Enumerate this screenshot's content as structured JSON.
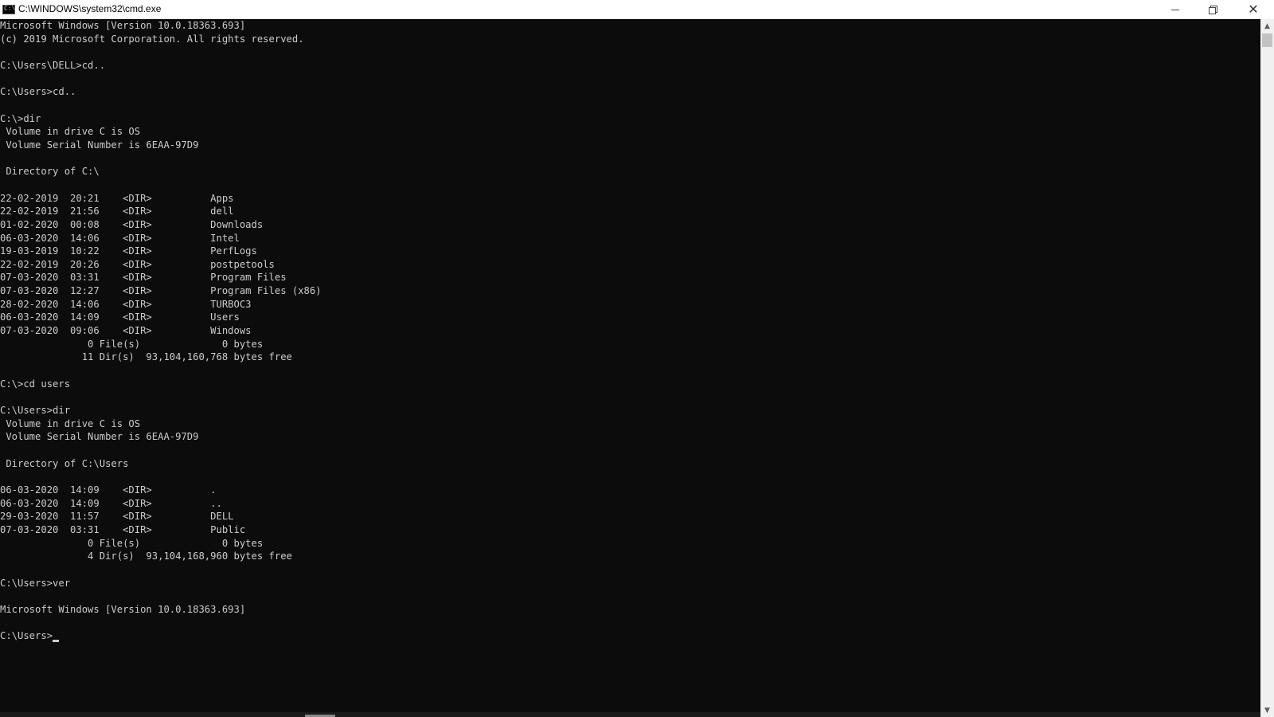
{
  "window": {
    "title": "C:\\WINDOWS\\system32\\cmd.exe",
    "icon": "cmd-icon",
    "icon_glyph": "C:\\",
    "buttons": {
      "minimize": "minimize-icon",
      "maximize": "restore-icon",
      "close": "close-icon",
      "close_glyph": "✕"
    }
  },
  "console": {
    "lines": [
      "Microsoft Windows [Version 10.0.18363.693]",
      "(c) 2019 Microsoft Corporation. All rights reserved.",
      "",
      "C:\\Users\\DELL>cd..",
      "",
      "C:\\Users>cd..",
      "",
      "C:\\>dir",
      " Volume in drive C is OS",
      " Volume Serial Number is 6EAA-97D9",
      "",
      " Directory of C:\\",
      "",
      "22-02-2019  20:21    <DIR>          Apps",
      "22-02-2019  21:56    <DIR>          dell",
      "01-02-2020  00:08    <DIR>          Downloads",
      "06-03-2020  14:06    <DIR>          Intel",
      "19-03-2019  10:22    <DIR>          PerfLogs",
      "22-02-2019  20:26    <DIR>          postpetools",
      "07-03-2020  03:31    <DIR>          Program Files",
      "07-03-2020  12:27    <DIR>          Program Files (x86)",
      "28-02-2020  14:06    <DIR>          TURBOC3",
      "06-03-2020  14:09    <DIR>          Users",
      "07-03-2020  09:06    <DIR>          Windows",
      "               0 File(s)              0 bytes",
      "              11 Dir(s)  93,104,160,768 bytes free",
      "",
      "C:\\>cd users",
      "",
      "C:\\Users>dir",
      " Volume in drive C is OS",
      " Volume Serial Number is 6EAA-97D9",
      "",
      " Directory of C:\\Users",
      "",
      "06-03-2020  14:09    <DIR>          .",
      "06-03-2020  14:09    <DIR>          ..",
      "29-03-2020  11:57    <DIR>          DELL",
      "07-03-2020  03:31    <DIR>          Public",
      "               0 File(s)              0 bytes",
      "               4 Dir(s)  93,104,168,960 bytes free",
      "",
      "C:\\Users>ver",
      "",
      "Microsoft Windows [Version 10.0.18363.693]",
      ""
    ],
    "prompt": "C:\\Users>"
  },
  "scrollbar": {
    "up_icon": "scroll-up-arrow-icon",
    "up_glyph": "▲",
    "down_icon": "scroll-down-arrow-icon",
    "down_glyph": "▼"
  },
  "colors": {
    "background": "#0c0c0c",
    "text": "#cccccc",
    "titlebar": "#ffffff"
  }
}
